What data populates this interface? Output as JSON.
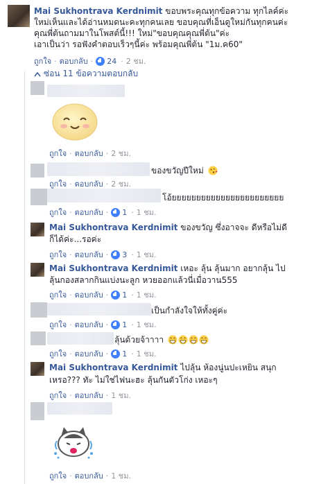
{
  "main_comment": {
    "author": "Mai Sukhontrava Kerdnimit",
    "lines": [
      "ขอบพระคุณทุกข้อความ ทุกไลค์ค่ะ",
      "ใหม่เห็นและได้อ่านหมดนะคะทุกคนเลย ขอบคุณที่เอ็นดูใหม่กันทุกคนค่ะ",
      "คุณพี่ต้นถามมาในโพสต์นี้!!! ใหม่\"ขอบคุณคุณพี่ต้น\"ค่ะ",
      "เอาเป็นว่า รอฟังคำตอบเร็วๆนี้ค่ะ พร้อมคุณพี่ต้น \"1ม.ค60\""
    ],
    "like_label": "ถูกใจ",
    "reply_label": "ตอบกลับ",
    "like_count": "24",
    "time": "2 ชม."
  },
  "hide_replies_label": "ซ่อน 11 ข้อความตอบกลับ",
  "replies": [
    {
      "text": "",
      "like_count": "",
      "time": "2 ชม."
    },
    {
      "text": "ของขวัญปีใหม่",
      "like_count": "",
      "time": "2 ชม."
    },
    {
      "text": "โอ้ยยยยยยยยยยยยยยยยยยยยยยย",
      "like_count": "1",
      "time": "1 ชม."
    },
    {
      "author": "Mai Sukhontrava Kerdnimit",
      "line1": "ของขวัญ ซึ่งอาจจะ ดีหรือไม่ดี",
      "line2": "ก็ได้ค่ะ...รอค่ะ",
      "like_count": "3",
      "time": "1 ชม."
    },
    {
      "author": "Mai Sukhontrava Kerdnimit",
      "line1": "เหอะ ลุ้น ลุ้นมาก อยากลุ้น ไป",
      "line2": "ลุ้นกองสลากกินแบ่งนะลูก หวยออกแล้วนี่เมื่อวาน555",
      "like_count": "1",
      "time": "1 ชม."
    },
    {
      "text": "เป็นกำลังใจให้ทั้งคู่ค่ะ",
      "like_count": "1",
      "time": "1 ชม."
    },
    {
      "text": "ลุ้นด้วยจ้าาาา",
      "like_count": "1",
      "time": "1 ชม."
    },
    {
      "author": "Mai Sukhontrava Kerdnimit",
      "line1": "ไปลุ้น ห้องนู่นปะเหยิน สนุก",
      "line2": "เหรอ??? ทัะ ไม่ใช่ไฟนะฮะ ลุ้นกันตัวโก่ง เหอะๆ",
      "like_count": "",
      "time": "1 ชม."
    },
    {
      "text": "",
      "like_count": "",
      "time": "1 ชม."
    }
  ],
  "labels": {
    "like": "ถูกใจ",
    "reply": "ตอบกลับ",
    "dot": "·"
  },
  "colors": {
    "link": "#365899",
    "meta": "#90949c",
    "like_badge": "#4080ff"
  }
}
